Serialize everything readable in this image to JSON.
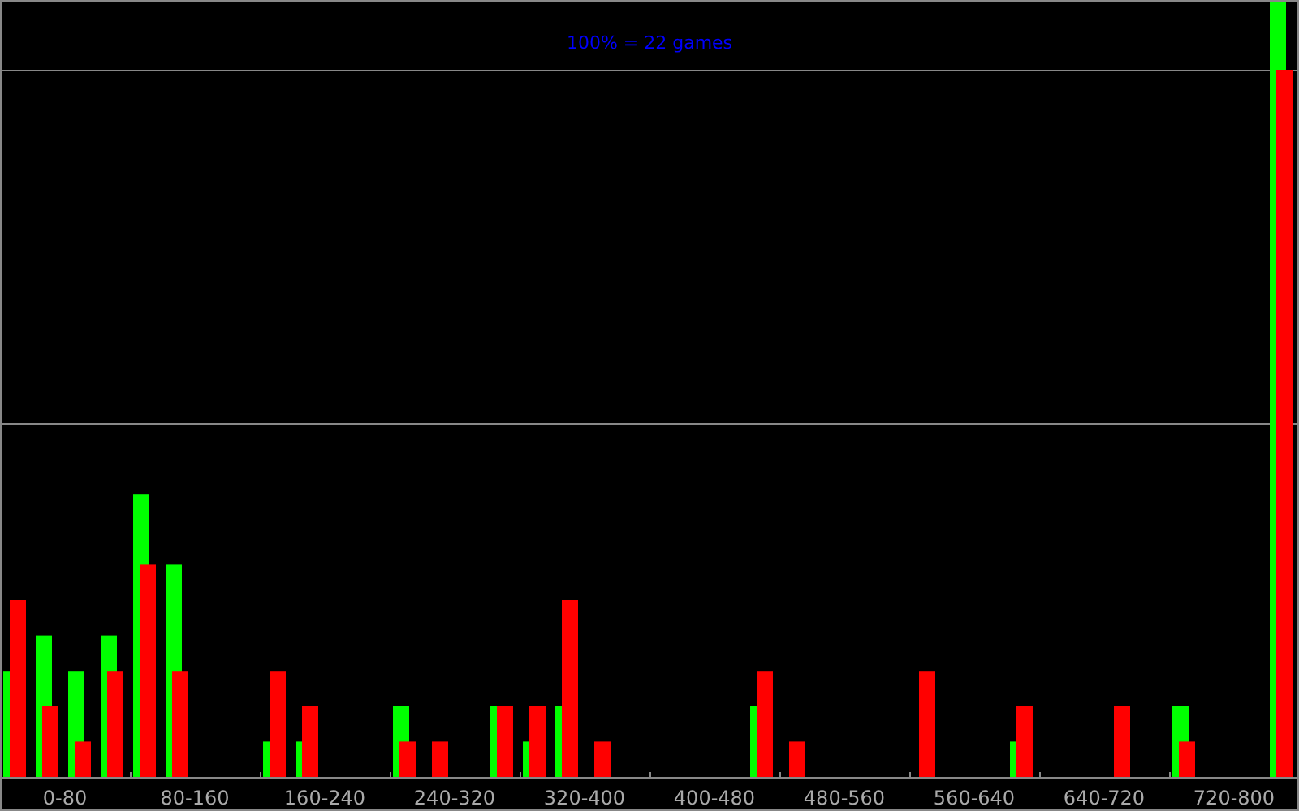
{
  "chart": {
    "title": "100% = 22 games",
    "x_labels": [
      "0-80",
      "80-160",
      "160-240",
      "240-320",
      "320-400",
      "400-480",
      "480-560",
      "560-640",
      "640-720",
      "720-800"
    ]
  }
}
